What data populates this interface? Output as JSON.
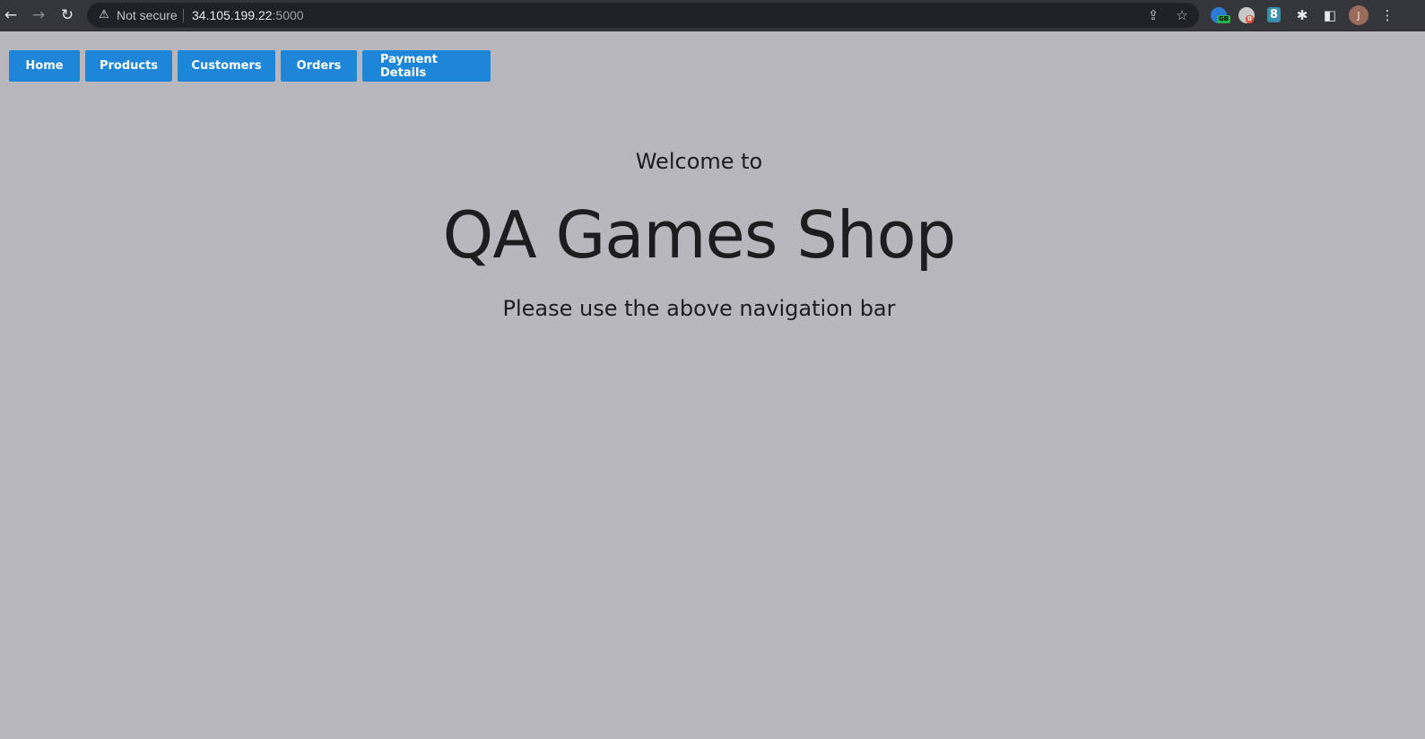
{
  "browser": {
    "back_icon": "←",
    "forward_icon": "→",
    "reload_icon": "↻",
    "security_icon": "⚠",
    "security_label": "Not secure",
    "url_host": "34.105.199.22",
    "url_port": ":5000",
    "share_icon": "⇪",
    "bookmark_icon": "☆",
    "extensions": {
      "gb_badge": "GB",
      "spy_badge": "0",
      "eight_label": "8",
      "puzzle_icon": "✱",
      "panel_icon": "◧",
      "avatar_letter": "J",
      "menu_icon": "⋮"
    }
  },
  "nav": {
    "items": [
      {
        "label": "Home"
      },
      {
        "label": "Products"
      },
      {
        "label": "Customers"
      },
      {
        "label": "Orders"
      },
      {
        "label": "Payment Details"
      }
    ]
  },
  "hero": {
    "welcome": "Welcome to",
    "title": "QA Games Shop",
    "subtitle": "Please use the above navigation bar"
  },
  "colors": {
    "page_background": "#b8b7bd",
    "nav_button": "#1e86d9",
    "text": "#1d1d1f"
  }
}
